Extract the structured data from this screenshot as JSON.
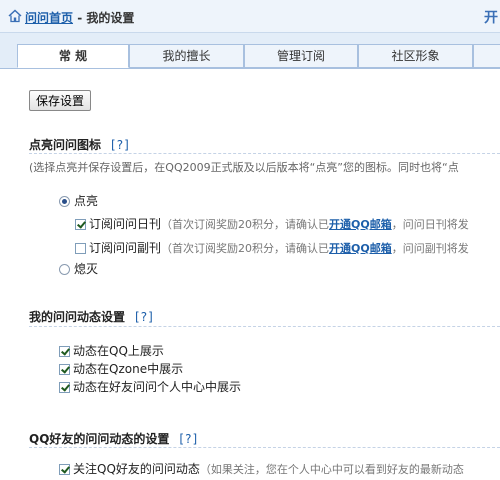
{
  "breadcrumb": {
    "home_link": "问问首页",
    "separator": " - ",
    "current": "我的设置"
  },
  "header_right_text": "开",
  "tabs": [
    {
      "label": "常 规",
      "active": true
    },
    {
      "label": "我的擅长",
      "active": false
    },
    {
      "label": "管理订阅",
      "active": false
    },
    {
      "label": "社区形象",
      "active": false
    }
  ],
  "save_button": "保存设置",
  "section_icon": {
    "title": "点亮问问图标",
    "help": "[?]",
    "note": "(选择点亮并保存设置后，在QQ2009正式版及以后版本将“点亮”您的图标。同时也将“点",
    "option_on": "点亮",
    "daily": {
      "label": "订阅问问日刊",
      "note_prefix": "（首次订阅奖励20积分，请确认已",
      "link": "开通QQ邮箱",
      "note_suffix": "，问问日刊将发"
    },
    "supplement": {
      "label": "订阅问问副刊",
      "note_prefix": "（首次订阅奖励20积分，请确认已",
      "link": "开通QQ邮箱",
      "note_suffix": "，问问副刊将发"
    },
    "option_off": "熄灭"
  },
  "section_activity": {
    "title": "我的问问动态设置",
    "help": "[?]",
    "items": [
      "动态在QQ上展示",
      "动态在Qzone中展示",
      "动态在好友问问个人中心中展示"
    ]
  },
  "section_friends": {
    "title": "QQ好友的问问动态的设置",
    "help": "[?]",
    "follow_label": "关注QQ好友的问问动态",
    "follow_note": "（如果关注，您在个人中心中可以看到好友的最新动态"
  }
}
